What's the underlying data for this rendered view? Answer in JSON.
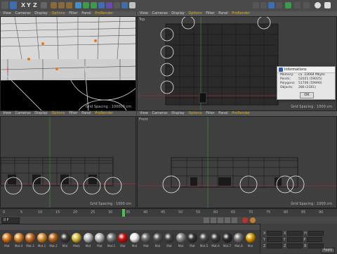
{
  "toolbar": {
    "axes": [
      "X",
      "Y",
      "Z"
    ]
  },
  "viewports": {
    "tl": {
      "menu": [
        "View",
        "Cameras",
        "Display",
        "Options",
        "Filter",
        "Panel",
        "ProRender"
      ],
      "grid_spacing": "Grid Spacing : 100000 cm"
    },
    "tr": {
      "menu": [
        "View",
        "Cameras",
        "Display",
        "Options",
        "Filter",
        "Panel",
        "ProRender"
      ],
      "name": "Top",
      "grid_spacing": "Grid Spacing : 1000 cm"
    },
    "bl": {
      "menu": [
        "View",
        "Cameras",
        "Display",
        "Options",
        "Filter",
        "Panel",
        "ProRender"
      ],
      "grid_spacing": "Grid Spacing : 1000 cm"
    },
    "br": {
      "menu": [
        "View",
        "Cameras",
        "Display",
        "Options",
        "Filter",
        "Panel",
        "ProRender"
      ],
      "name": "Front",
      "grid_spacing": "Grid Spacing : 1000 cm"
    }
  },
  "info_dialog": {
    "title": "Informations",
    "rows": [
      {
        "label": "Memory:",
        "value": "ca. 33668 Mbyte"
      },
      {
        "label": "Points:",
        "value": "52021 (59025)"
      },
      {
        "label": "Polygons:",
        "value": "51706 (59990)"
      },
      {
        "label": "Objects:",
        "value": "286 (2301)"
      }
    ],
    "ok_label": "OK"
  },
  "timeline": {
    "ticks": [
      "0",
      "5",
      "10",
      "15",
      "20",
      "25",
      "30",
      "35",
      "40",
      "45",
      "50",
      "55",
      "60",
      "65",
      "70",
      "75",
      "80",
      "85",
      "90"
    ],
    "current_frame": "0 F"
  },
  "materials": {
    "labels": [
      "Mat",
      "Mat.4",
      "Mat.3",
      "Mat.1",
      "Mat.2",
      "Mat",
      "Matz",
      "Mat",
      "Mat",
      "Mat.1",
      "Mat",
      "Mat",
      "Mat",
      "Mat",
      "Mat",
      "Mat",
      "Mat",
      "Mat.5",
      "Mat.6",
      "Mat.7",
      "Mat.8",
      "Mat"
    ],
    "colors": [
      "#e07a1a",
      "#e08a2a",
      "#d07020",
      "#e09030",
      "#c06818",
      "#3a3a3a",
      "#e0c040",
      "#c0c0c0",
      "#bdbdbd",
      "#7a7a7a",
      "#d01010",
      "#f0f0f0",
      "#6a6a6a",
      "#555",
      "#444",
      "#888",
      "#333",
      "#4a4a4a",
      "#3a3a3a",
      "#2a2a2a",
      "#777",
      "#e0a000"
    ]
  },
  "coordinates": {
    "rows": [
      {
        "axis": "X",
        "v1": "0 cm",
        "axis2": "X",
        "v2": "0 cm",
        "axis3": "H",
        "v3": "0 °"
      },
      {
        "axis": "Y",
        "v1": "0 cm",
        "axis2": "Y",
        "v2": "0 cm",
        "axis3": "P",
        "v3": "0 °"
      },
      {
        "axis": "Z",
        "v1": "0 cm",
        "axis2": "Z",
        "v2": "0 cm",
        "axis3": "B",
        "v3": "0 °"
      }
    ],
    "apply_label": "Apply"
  }
}
